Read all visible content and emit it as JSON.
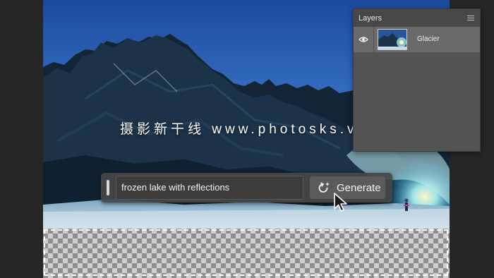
{
  "watermark": {
    "text": "摄影新干线 www.photosks.vip"
  },
  "generative_fill": {
    "prompt_value": "frozen lake with reflections",
    "generate_label": "Generate",
    "generate_icon": "sparkle-refresh-icon"
  },
  "layers_panel": {
    "title": "Layers",
    "menu_icon": "hamburger-menu-icon",
    "layers": [
      {
        "name": "Glacier",
        "visible": true,
        "eye_icon": "eye-icon"
      }
    ]
  },
  "colors": {
    "sky_top": "#1d4fa3",
    "panel_bg": "#535353",
    "selection_marching_ants": "#ffffff"
  }
}
